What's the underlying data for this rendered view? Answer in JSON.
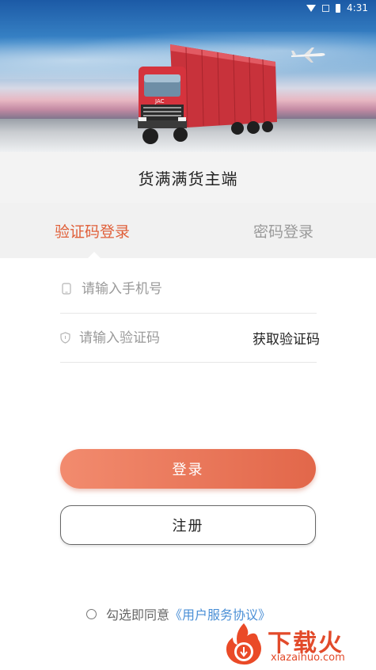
{
  "status_bar": {
    "time": "4:31",
    "icons": [
      "wifi-icon",
      "signal-icon",
      "battery-icon"
    ]
  },
  "app": {
    "title": "货满满货主端"
  },
  "tabs": [
    {
      "label": "验证码登录",
      "active": true
    },
    {
      "label": "密码登录",
      "active": false
    }
  ],
  "form": {
    "phone_placeholder": "请输入手机号",
    "phone_value": "",
    "code_placeholder": "请输入验证码",
    "code_value": "",
    "get_code_label": "获取验证码",
    "phone_icon": "phone-icon",
    "shield_icon": "shield-icon"
  },
  "buttons": {
    "login": "登录",
    "register": "注册"
  },
  "agreement": {
    "prefix": "勾选即同意",
    "link": "《用户服务协议》",
    "checked": false
  },
  "watermark": {
    "brand": "下载火",
    "url": "xiazaihuo.com"
  },
  "colors": {
    "accent": "#e0603a",
    "link": "#4a8fd6",
    "login_gradient_start": "#f28b6e",
    "login_gradient_end": "#e2674a"
  }
}
